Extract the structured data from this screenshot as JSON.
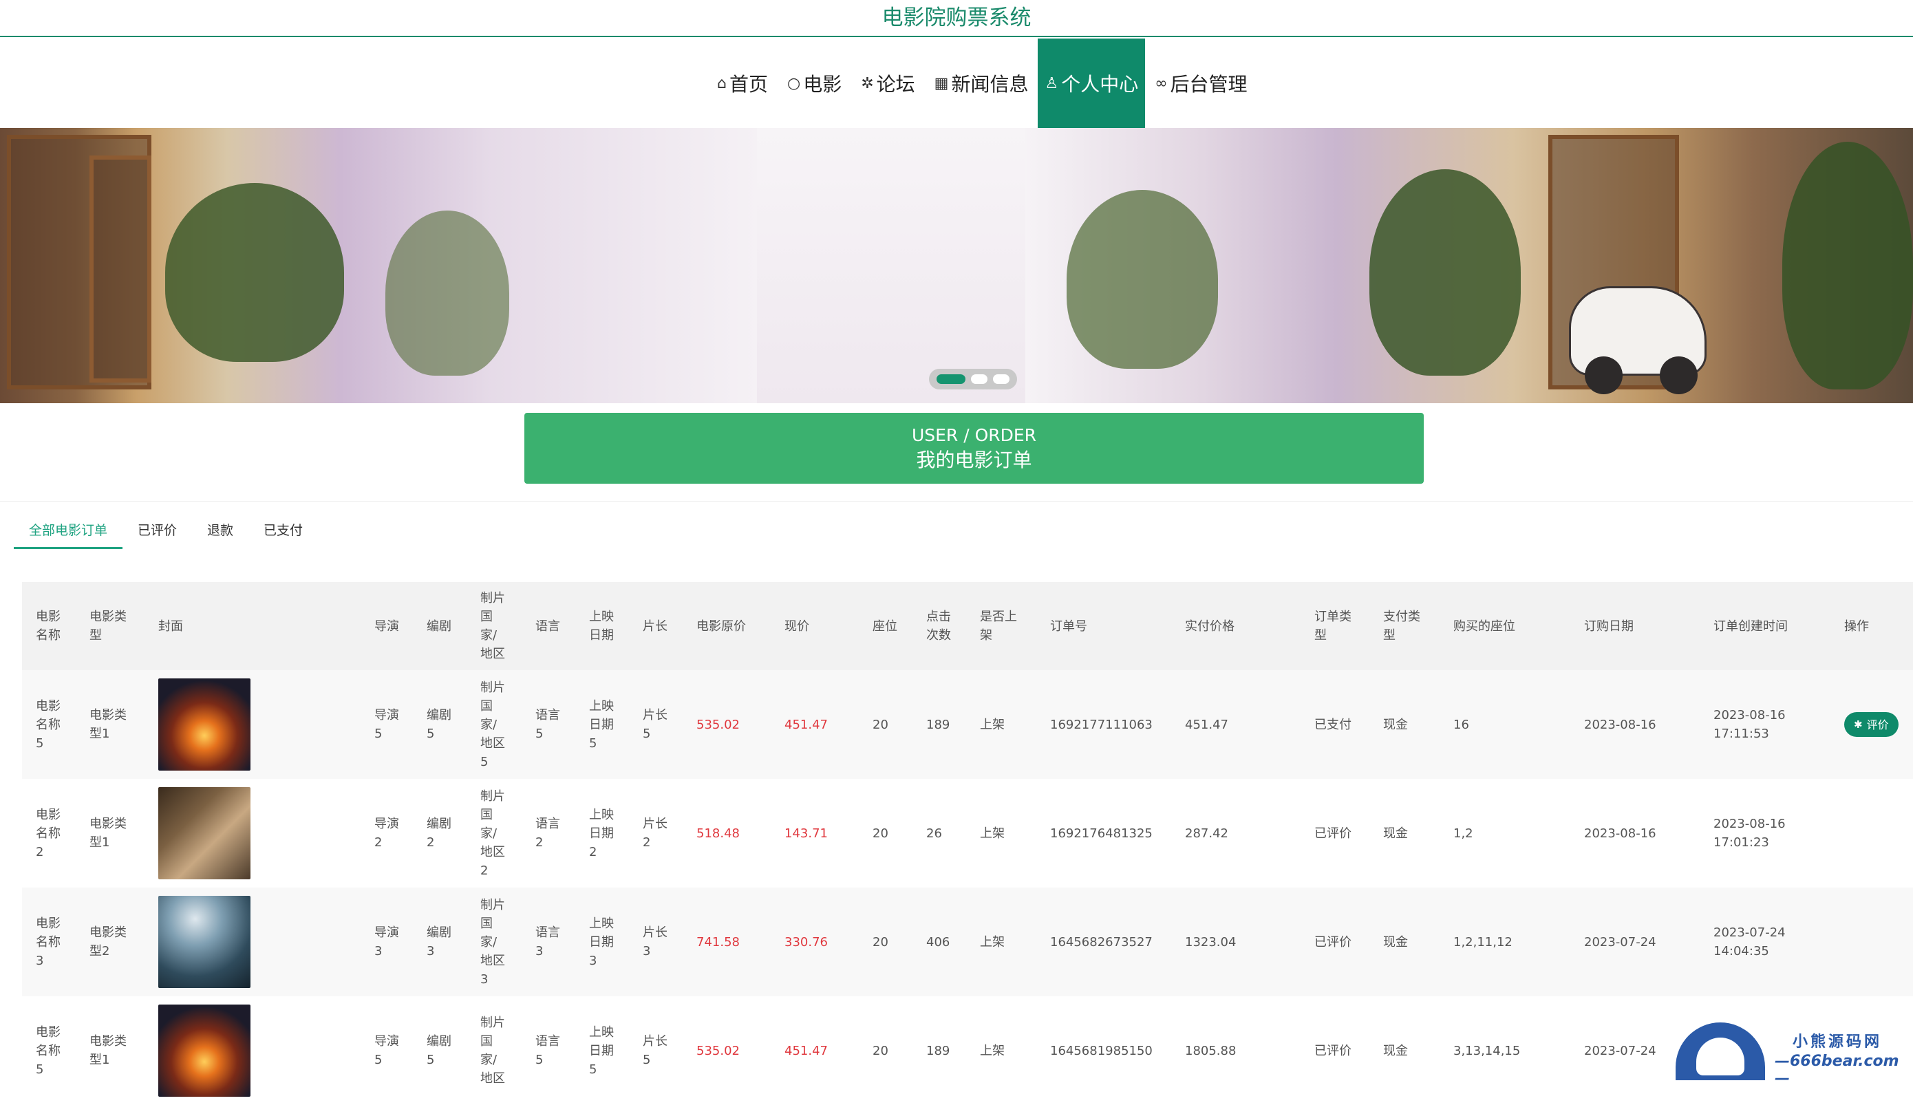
{
  "site": {
    "title": "电影院购票系统"
  },
  "nav": [
    {
      "icon": "home-icon",
      "glyph": "⌂",
      "label": "首页",
      "active": false
    },
    {
      "icon": "film-icon",
      "glyph": "○",
      "label": "电影",
      "active": false
    },
    {
      "icon": "forum-icon",
      "glyph": "✲",
      "label": "论坛",
      "active": false
    },
    {
      "icon": "news-icon",
      "glyph": "▦",
      "label": "新闻信息",
      "active": false
    },
    {
      "icon": "user-icon",
      "glyph": "♙",
      "label": "个人中心",
      "active": true
    },
    {
      "icon": "link-icon",
      "glyph": "∞",
      "label": "后台管理",
      "active": false
    }
  ],
  "banner": {
    "slides": 3,
    "active_slide": 1
  },
  "section": {
    "en": "USER / ORDER",
    "cn": "我的电影订单"
  },
  "tabs": [
    {
      "label": "全部电影订单",
      "active": true
    },
    {
      "label": "已评价",
      "active": false
    },
    {
      "label": "退款",
      "active": false
    },
    {
      "label": "已支付",
      "active": false
    }
  ],
  "table": {
    "headers": [
      "电影\n名称",
      "电影类\n型",
      "封面",
      "导演",
      "编剧",
      "制片\n国\n家/\n地区",
      "语言",
      "上映\n日期",
      "片长",
      "电影原价",
      "现价",
      "座位",
      "点击\n次数",
      "是否上\n架",
      "订单号",
      "实付价格",
      "订单类\n型",
      "支付类\n型",
      "购买的座位",
      "订购日期",
      "订单创建时间",
      "操作"
    ],
    "rows": [
      {
        "name": "电影\n名称\n5",
        "type": "电影类\n型1",
        "cover": "a",
        "director": "导演\n5",
        "writer": "编剧\n5",
        "country": "制片\n国\n家/\n地区\n5",
        "lang": "语言\n5",
        "release": "上映\n日期\n5",
        "length": "片长\n5",
        "orig_price": "535.02",
        "price": "451.47",
        "seats": "20",
        "clicks": "189",
        "onsale": "上架",
        "order_no": "1692177111063",
        "paid": "451.47",
        "order_type": "已支付",
        "pay_type": "现金",
        "bought_seats": "16",
        "order_date": "2023-08-16",
        "created": "2023-08-16\n17:11:53",
        "action": "评价"
      },
      {
        "name": "电影\n名称\n2",
        "type": "电影类\n型1",
        "cover": "b",
        "director": "导演\n2",
        "writer": "编剧\n2",
        "country": "制片\n国\n家/\n地区\n2",
        "lang": "语言\n2",
        "release": "上映\n日期\n2",
        "length": "片长\n2",
        "orig_price": "518.48",
        "price": "143.71",
        "seats": "20",
        "clicks": "26",
        "onsale": "上架",
        "order_no": "1692176481325",
        "paid": "287.42",
        "order_type": "已评价",
        "pay_type": "现金",
        "bought_seats": "1,2",
        "order_date": "2023-08-16",
        "created": "2023-08-16\n17:01:23",
        "action": ""
      },
      {
        "name": "电影\n名称\n3",
        "type": "电影类\n型2",
        "cover": "c",
        "director": "导演\n3",
        "writer": "编剧\n3",
        "country": "制片\n国\n家/\n地区\n3",
        "lang": "语言\n3",
        "release": "上映\n日期\n3",
        "length": "片长\n3",
        "orig_price": "741.58",
        "price": "330.76",
        "seats": "20",
        "clicks": "406",
        "onsale": "上架",
        "order_no": "1645682673527",
        "paid": "1323.04",
        "order_type": "已评价",
        "pay_type": "现金",
        "bought_seats": "1,2,11,12",
        "order_date": "2023-07-24",
        "created": "2023-07-24\n14:04:35",
        "action": ""
      },
      {
        "name": "电影\n名称\n5",
        "type": "电影类\n型1",
        "cover": "a",
        "director": "导演\n5",
        "writer": "编剧\n5",
        "country": "制片\n国\n家/\n地区",
        "lang": "语言\n5",
        "release": "上映\n日期\n5",
        "length": "片长\n5",
        "orig_price": "535.02",
        "price": "451.47",
        "seats": "20",
        "clicks": "189",
        "onsale": "上架",
        "order_no": "1645681985150",
        "paid": "1805.88",
        "order_type": "已评价",
        "pay_type": "现金",
        "bought_seats": "3,13,14,15",
        "order_date": "2023-07-24",
        "created": "",
        "action": ""
      }
    ]
  },
  "watermark": {
    "line1": "小熊源码网",
    "line2": "—666bear.com—"
  }
}
